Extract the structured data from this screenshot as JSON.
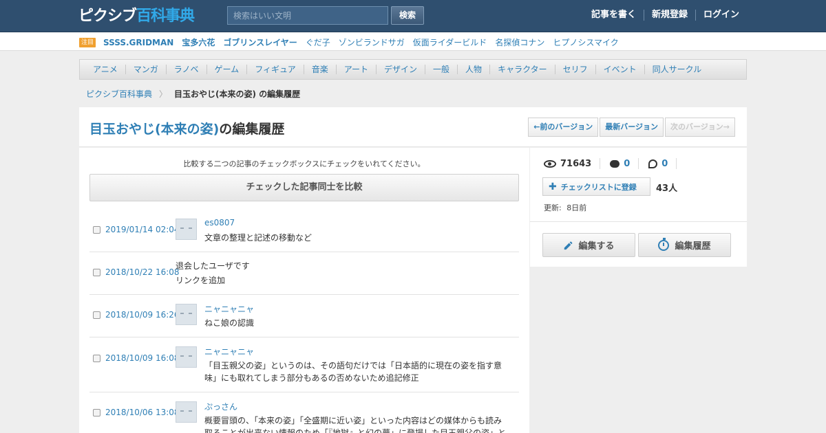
{
  "header": {
    "logo_pixiv": "ピクシブ",
    "logo_hyakka": "百科事典",
    "search_placeholder": "検索はいい文明",
    "search_button": "検索",
    "links": [
      "記事を書く",
      "新規登録",
      "ログイン"
    ]
  },
  "trending": {
    "badge": "注目",
    "items": [
      {
        "label": "SSSS.GRIDMAN",
        "bold": true
      },
      {
        "label": "宝多六花",
        "bold": true
      },
      {
        "label": "ゴブリンスレイヤー",
        "bold": true
      },
      {
        "label": "ぐだ子",
        "bold": false
      },
      {
        "label": "ゾンビランドサガ",
        "bold": false
      },
      {
        "label": "仮面ライダービルド",
        "bold": false
      },
      {
        "label": "名探偵コナン",
        "bold": false
      },
      {
        "label": "ヒプノシスマイク",
        "bold": false
      }
    ]
  },
  "categories": [
    "アニメ",
    "マンガ",
    "ラノベ",
    "ゲーム",
    "フィギュア",
    "音楽",
    "アート",
    "デザイン",
    "一般",
    "人物",
    "キャラクター",
    "セリフ",
    "イベント",
    "同人サークル"
  ],
  "breadcrumb": {
    "home": "ピクシブ百科事典",
    "separator": "〉",
    "current": "目玉おやじ(本来の姿) の編集履歴"
  },
  "title": {
    "article": "目玉おやじ(本来の姿)",
    "suffix": "の編集履歴"
  },
  "version_buttons": {
    "prev": "←前のバージョン",
    "latest": "最新バージョン",
    "next": "次のバージョン→"
  },
  "instruction": "比較する二つの記事のチェックボックスにチェックをいれてください。",
  "compare_button": "チェックした記事同士を比較",
  "revisions": [
    {
      "date": "2019/01/14 02:04",
      "user": "es0807",
      "note": "文章の整理と記述の移動など",
      "has_avatar": true
    },
    {
      "date": "2018/10/22 16:08",
      "user": "退会したユーザです",
      "note": "リンクを追加",
      "has_avatar": false
    },
    {
      "date": "2018/10/09 16:26",
      "user": "ニャニャニャ",
      "note": "ねこ娘の認識",
      "has_avatar": true
    },
    {
      "date": "2018/10/09 16:08",
      "user": "ニャニャニャ",
      "note": "「目玉親父の姿」というのは、その語句だけでは「日本語的に現在の姿を指す意味」にも取れてしまう部分もあるの否めないため追記修正",
      "has_avatar": true
    },
    {
      "date": "2018/10/06 13:08",
      "user": "ぷっさん",
      "note": "概要冒頭の、「本来の姿」「全盛期に近い姿」といった内容はどの媒体からも読み取ることが出来ない情報のため「『地獄』と幻の夢」に登場した目玉親父の姿」と",
      "has_avatar": true
    }
  ],
  "sidebar": {
    "views": "71643",
    "comments": "0",
    "pins": "0",
    "checklist_button": "チェックリストに登録",
    "checklist_count": "43人",
    "updated_label": "更新:",
    "updated_value": "8日前",
    "edit_button": "編集する",
    "history_button": "編集履歴"
  }
}
